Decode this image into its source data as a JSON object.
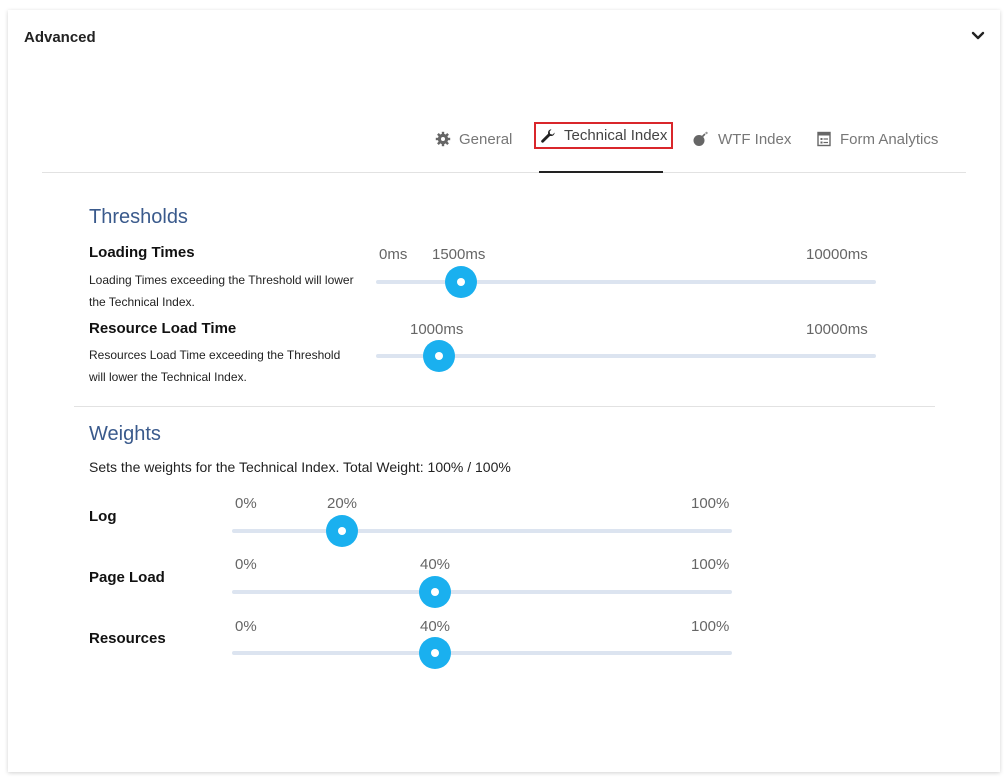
{
  "header": {
    "title": "Advanced"
  },
  "tabs": [
    {
      "label": "General",
      "icon": "gear-icon"
    },
    {
      "label": "Technical Index",
      "icon": "wrench-icon",
      "active": true
    },
    {
      "label": "WTF Index",
      "icon": "bomb-icon"
    },
    {
      "label": "Form Analytics",
      "icon": "form-icon"
    }
  ],
  "thresholds": {
    "title": "Thresholds",
    "loading_times": {
      "label": "Loading Times",
      "description": "Loading Times exceeding the Threshold will lower the Technical Index.",
      "min_label": "0ms",
      "value_label": "1500ms",
      "max_label": "10000ms",
      "value": 1500
    },
    "resource_load_time": {
      "label": "Resource Load Time",
      "description": "Resources Load Time exceeding the Threshold will lower the Technical Index.",
      "value_label": "1000ms",
      "max_label": "10000ms",
      "value": 1000
    }
  },
  "weights": {
    "title": "Weights",
    "description": "Sets the weights for the Technical Index. Total Weight: 100% / 100%",
    "items": [
      {
        "label": "Log",
        "min_label": "0%",
        "value_label": "20%",
        "max_label": "100%",
        "value": 20
      },
      {
        "label": "Page Load",
        "min_label": "0%",
        "value_label": "40%",
        "max_label": "100%",
        "value": 40
      },
      {
        "label": "Resources",
        "min_label": "0%",
        "value_label": "40%",
        "max_label": "100%",
        "value": 40
      }
    ]
  },
  "colors": {
    "accent": "#1ab0ef",
    "title": "#3a5a8c",
    "active_outline": "#d9262b"
  }
}
